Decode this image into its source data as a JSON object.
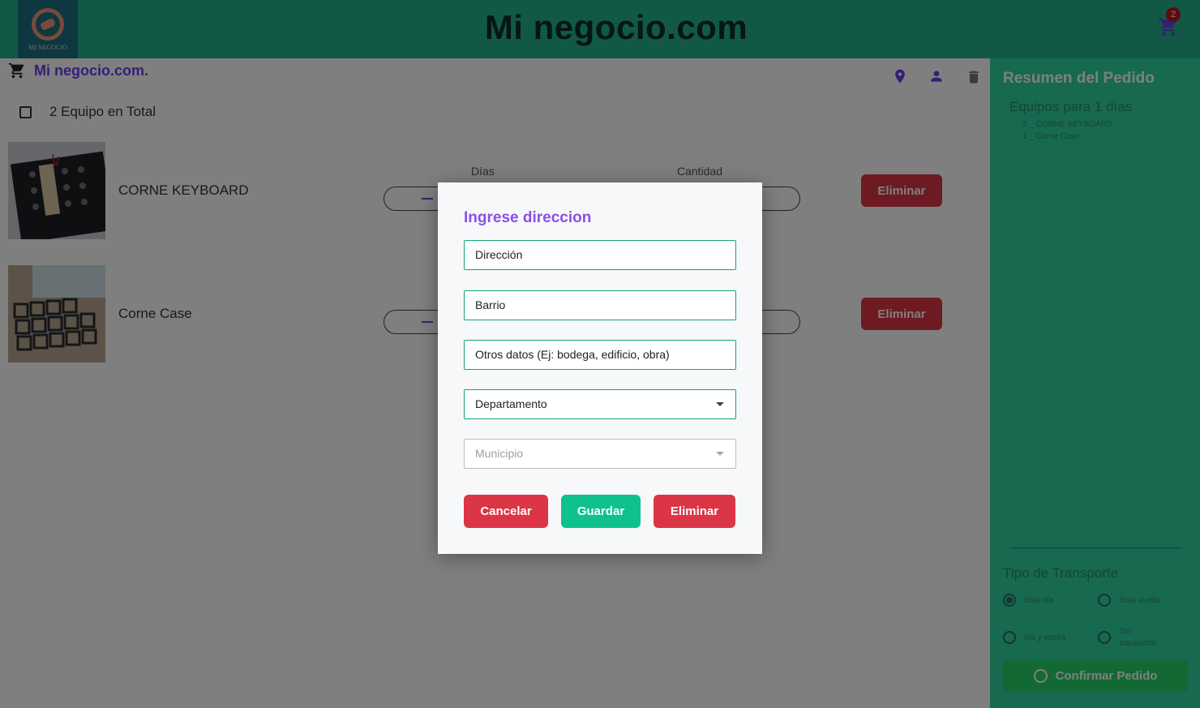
{
  "header": {
    "title": "Mi negocio.com",
    "logo_text": "MI NEGOCIO",
    "cart_count": "2"
  },
  "toolbar": {
    "brand_link": "Mi negocio.com.",
    "total_label": "2 Equipo en Total"
  },
  "products": [
    {
      "name": "CORNE KEYBOARD",
      "days_label": "Días",
      "qty_label": "Cantidad",
      "delete_label": "Eliminar"
    },
    {
      "name": "Corne Case",
      "delete_label": "Eliminar"
    }
  ],
  "sidebar": {
    "title": "Resumen del Pedido",
    "subtitle": "Equipos para 1 días",
    "items": [
      "2 _ CORNE KEYBOARD",
      "1 _ Corne Case"
    ],
    "transport_title": "Tipo de Transporte",
    "transport_options": [
      {
        "label": "Solo ida",
        "selected": true
      },
      {
        "label": "Solo vuelta",
        "selected": false
      },
      {
        "label": "Ida y vuelta",
        "selected": false
      },
      {
        "label_line1": "Sin",
        "label_line2": "transporte",
        "selected": false
      }
    ],
    "confirm_label": "Confirmar Pedido"
  },
  "modal": {
    "title": "Ingrese direccion",
    "address_placeholder": "Dirección",
    "neighborhood_placeholder": "Barrio",
    "other_placeholder": "Otros datos (Ej: bodega, edificio, obra)",
    "department_label": "Departamento",
    "municipality_label": "Municipio",
    "cancel_label": "Cancelar",
    "save_label": "Guardar",
    "delete_label": "Eliminar"
  },
  "colors": {
    "header": "#22b38a",
    "sidebar": "#2ed3a0",
    "danger": "#dc3545",
    "success": "#0fc18f",
    "accent": "#8a50e8"
  }
}
